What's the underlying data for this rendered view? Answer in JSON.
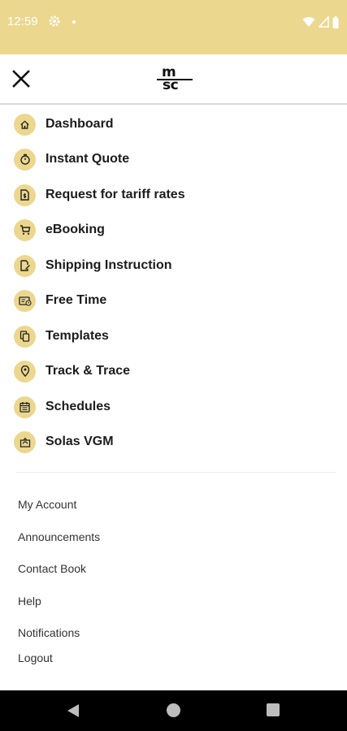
{
  "status_bar": {
    "time": "12:59",
    "background_color": "#ecd78f"
  },
  "header": {
    "logo_line1": "m",
    "logo_line2": "sc",
    "close_icon": "close-icon"
  },
  "primary_menu": [
    {
      "label": "Dashboard",
      "icon": "home-icon"
    },
    {
      "label": "Instant Quote",
      "icon": "stopwatch-icon"
    },
    {
      "label": "Request for tariff rates",
      "icon": "dollar-document-icon"
    },
    {
      "label": "eBooking",
      "icon": "cart-icon"
    },
    {
      "label": "Shipping Instruction",
      "icon": "edit-document-icon"
    },
    {
      "label": "Free Time",
      "icon": "ticket-clock-icon"
    },
    {
      "label": "Templates",
      "icon": "copy-icon"
    },
    {
      "label": "Track & Trace",
      "icon": "location-pin-icon"
    },
    {
      "label": "Schedules",
      "icon": "calendar-icon"
    },
    {
      "label": "Solas VGM",
      "icon": "weight-scale-icon"
    }
  ],
  "secondary_menu": [
    {
      "label": "My Account"
    },
    {
      "label": "Announcements"
    },
    {
      "label": "Contact Book"
    },
    {
      "label": "Help"
    },
    {
      "label": "Notifications"
    },
    {
      "label": "Logout"
    }
  ],
  "colors": {
    "accent": "#ecd78f",
    "text": "#1c1c1c"
  }
}
